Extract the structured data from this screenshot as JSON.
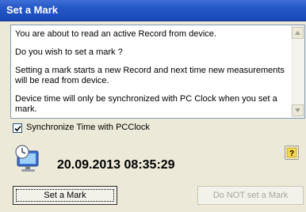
{
  "window": {
    "title": "Set a Mark"
  },
  "message": {
    "lines": [
      "You are about to read an active Record from device.",
      "Do you wish to set a mark ?",
      "Setting a mark starts a new Record and next time new measurements will be read from device.",
      "Device time will only be synchronized with PC Clock when you set a mark."
    ]
  },
  "sync": {
    "label": "Synchronize Time with PCClock",
    "checked": true
  },
  "clock": {
    "datetime": "20.09.2013 08:35:29",
    "icon": "pc-clock-icon"
  },
  "help": {
    "label": "?"
  },
  "buttons": {
    "set_mark": "Set a Mark",
    "do_not_set_mark": "Do NOT set a Mark"
  },
  "colors": {
    "titlebar": "#2457c7",
    "dialog_bg": "#ece9d8",
    "disabled_text": "#a7a69c"
  }
}
